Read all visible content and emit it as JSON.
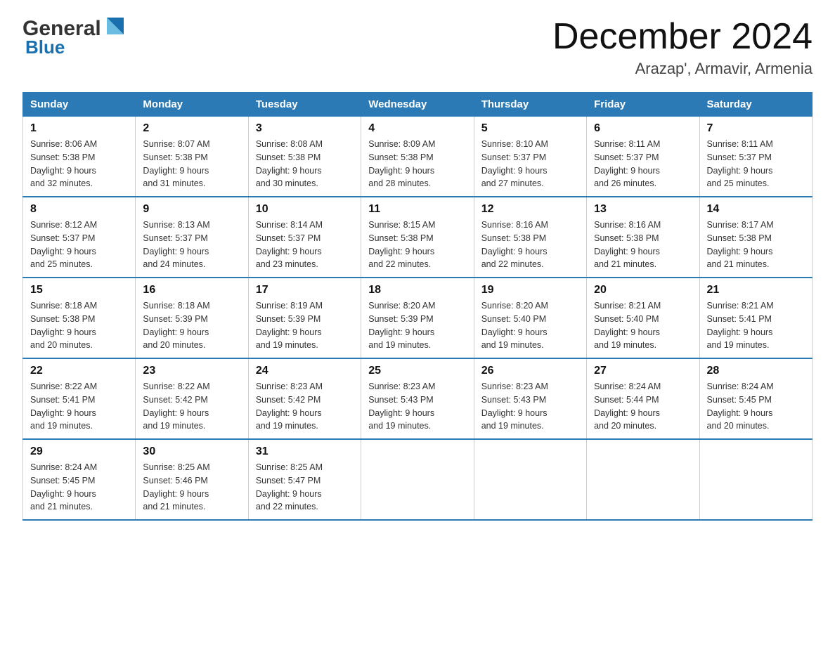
{
  "header": {
    "logo_general": "General",
    "logo_blue": "Blue",
    "month": "December 2024",
    "location": "Arazap', Armavir, Armenia"
  },
  "days_of_week": [
    "Sunday",
    "Monday",
    "Tuesday",
    "Wednesday",
    "Thursday",
    "Friday",
    "Saturday"
  ],
  "weeks": [
    [
      {
        "day": "1",
        "sunrise": "8:06 AM",
        "sunset": "5:38 PM",
        "daylight": "9 hours and 32 minutes."
      },
      {
        "day": "2",
        "sunrise": "8:07 AM",
        "sunset": "5:38 PM",
        "daylight": "9 hours and 31 minutes."
      },
      {
        "day": "3",
        "sunrise": "8:08 AM",
        "sunset": "5:38 PM",
        "daylight": "9 hours and 30 minutes."
      },
      {
        "day": "4",
        "sunrise": "8:09 AM",
        "sunset": "5:38 PM",
        "daylight": "9 hours and 28 minutes."
      },
      {
        "day": "5",
        "sunrise": "8:10 AM",
        "sunset": "5:37 PM",
        "daylight": "9 hours and 27 minutes."
      },
      {
        "day": "6",
        "sunrise": "8:11 AM",
        "sunset": "5:37 PM",
        "daylight": "9 hours and 26 minutes."
      },
      {
        "day": "7",
        "sunrise": "8:11 AM",
        "sunset": "5:37 PM",
        "daylight": "9 hours and 25 minutes."
      }
    ],
    [
      {
        "day": "8",
        "sunrise": "8:12 AM",
        "sunset": "5:37 PM",
        "daylight": "9 hours and 25 minutes."
      },
      {
        "day": "9",
        "sunrise": "8:13 AM",
        "sunset": "5:37 PM",
        "daylight": "9 hours and 24 minutes."
      },
      {
        "day": "10",
        "sunrise": "8:14 AM",
        "sunset": "5:37 PM",
        "daylight": "9 hours and 23 minutes."
      },
      {
        "day": "11",
        "sunrise": "8:15 AM",
        "sunset": "5:38 PM",
        "daylight": "9 hours and 22 minutes."
      },
      {
        "day": "12",
        "sunrise": "8:16 AM",
        "sunset": "5:38 PM",
        "daylight": "9 hours and 22 minutes."
      },
      {
        "day": "13",
        "sunrise": "8:16 AM",
        "sunset": "5:38 PM",
        "daylight": "9 hours and 21 minutes."
      },
      {
        "day": "14",
        "sunrise": "8:17 AM",
        "sunset": "5:38 PM",
        "daylight": "9 hours and 21 minutes."
      }
    ],
    [
      {
        "day": "15",
        "sunrise": "8:18 AM",
        "sunset": "5:38 PM",
        "daylight": "9 hours and 20 minutes."
      },
      {
        "day": "16",
        "sunrise": "8:18 AM",
        "sunset": "5:39 PM",
        "daylight": "9 hours and 20 minutes."
      },
      {
        "day": "17",
        "sunrise": "8:19 AM",
        "sunset": "5:39 PM",
        "daylight": "9 hours and 19 minutes."
      },
      {
        "day": "18",
        "sunrise": "8:20 AM",
        "sunset": "5:39 PM",
        "daylight": "9 hours and 19 minutes."
      },
      {
        "day": "19",
        "sunrise": "8:20 AM",
        "sunset": "5:40 PM",
        "daylight": "9 hours and 19 minutes."
      },
      {
        "day": "20",
        "sunrise": "8:21 AM",
        "sunset": "5:40 PM",
        "daylight": "9 hours and 19 minutes."
      },
      {
        "day": "21",
        "sunrise": "8:21 AM",
        "sunset": "5:41 PM",
        "daylight": "9 hours and 19 minutes."
      }
    ],
    [
      {
        "day": "22",
        "sunrise": "8:22 AM",
        "sunset": "5:41 PM",
        "daylight": "9 hours and 19 minutes."
      },
      {
        "day": "23",
        "sunrise": "8:22 AM",
        "sunset": "5:42 PM",
        "daylight": "9 hours and 19 minutes."
      },
      {
        "day": "24",
        "sunrise": "8:23 AM",
        "sunset": "5:42 PM",
        "daylight": "9 hours and 19 minutes."
      },
      {
        "day": "25",
        "sunrise": "8:23 AM",
        "sunset": "5:43 PM",
        "daylight": "9 hours and 19 minutes."
      },
      {
        "day": "26",
        "sunrise": "8:23 AM",
        "sunset": "5:43 PM",
        "daylight": "9 hours and 19 minutes."
      },
      {
        "day": "27",
        "sunrise": "8:24 AM",
        "sunset": "5:44 PM",
        "daylight": "9 hours and 20 minutes."
      },
      {
        "day": "28",
        "sunrise": "8:24 AM",
        "sunset": "5:45 PM",
        "daylight": "9 hours and 20 minutes."
      }
    ],
    [
      {
        "day": "29",
        "sunrise": "8:24 AM",
        "sunset": "5:45 PM",
        "daylight": "9 hours and 21 minutes."
      },
      {
        "day": "30",
        "sunrise": "8:25 AM",
        "sunset": "5:46 PM",
        "daylight": "9 hours and 21 minutes."
      },
      {
        "day": "31",
        "sunrise": "8:25 AM",
        "sunset": "5:47 PM",
        "daylight": "9 hours and 22 minutes."
      },
      null,
      null,
      null,
      null
    ]
  ],
  "labels": {
    "sunrise": "Sunrise:",
    "sunset": "Sunset:",
    "daylight": "Daylight:"
  }
}
